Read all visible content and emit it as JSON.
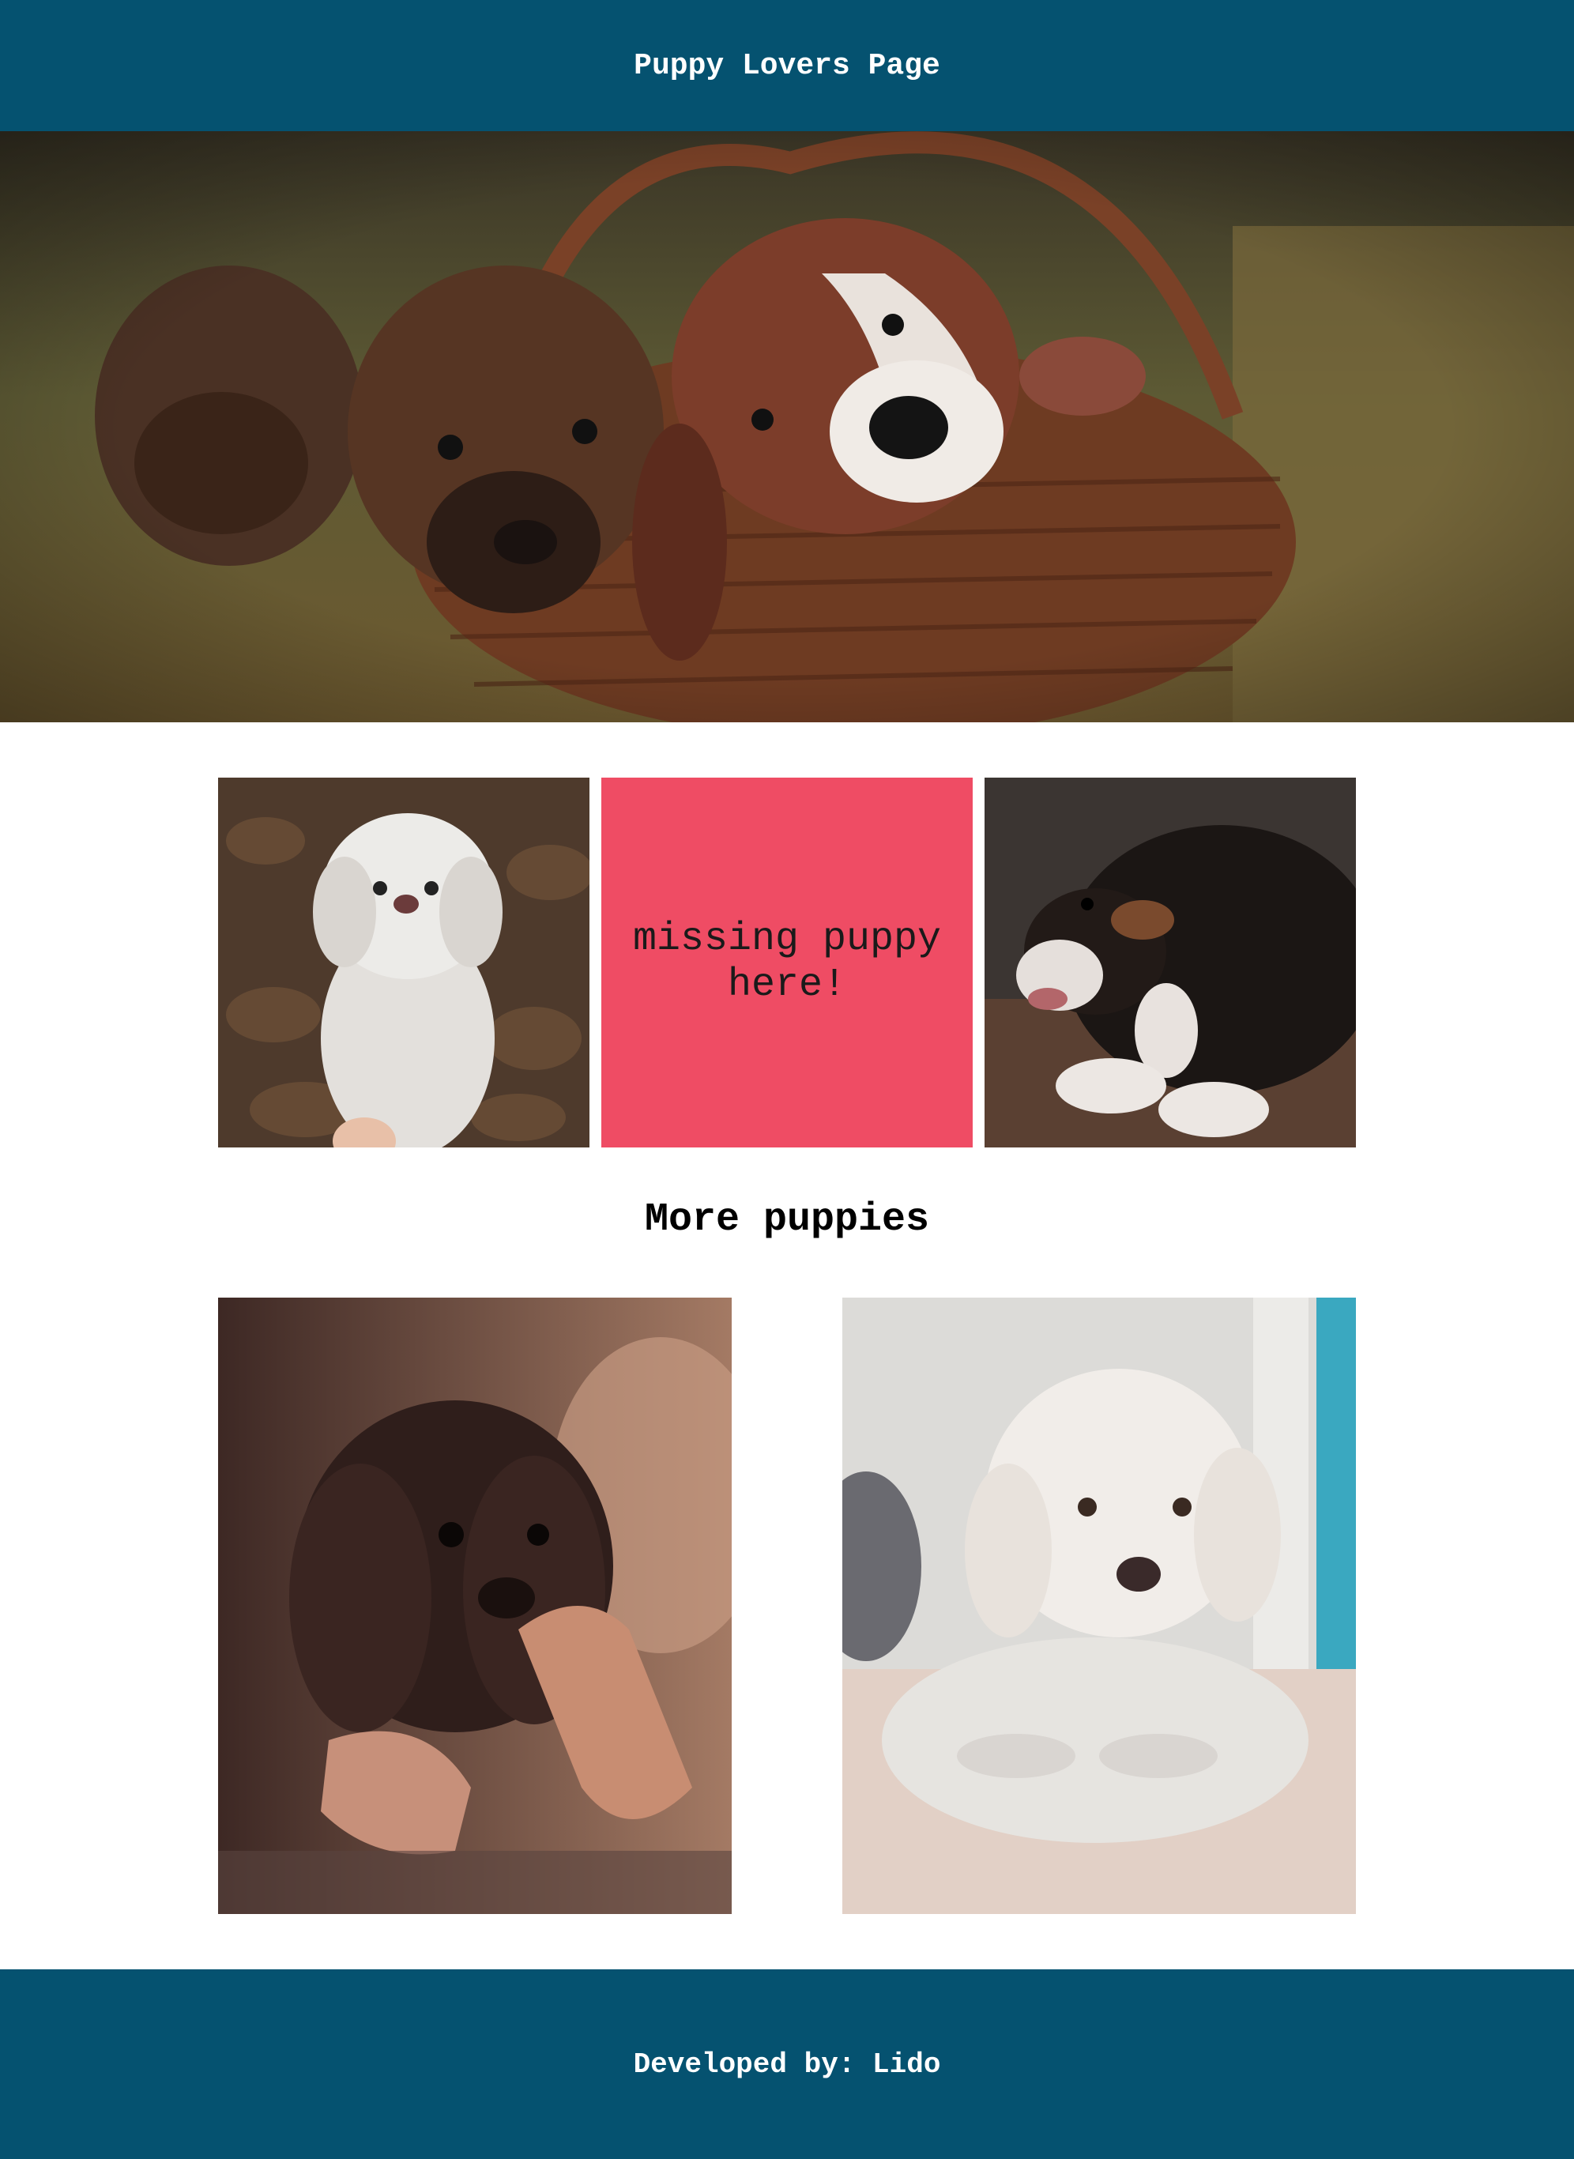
{
  "header": {
    "title": "Puppy Lovers Page"
  },
  "hero": {
    "image": "puppies-in-basket-photo"
  },
  "gallery": {
    "tiles": [
      {
        "image": "white-curly-puppy-photo"
      },
      {
        "placeholder_text": "missing puppy here!",
        "color": "#ef4c64"
      },
      {
        "image": "black-puppy-photo"
      }
    ]
  },
  "more": {
    "title": "More puppies",
    "images": [
      "brown-spaniel-puppy-photo",
      "white-poodle-dog-photo"
    ]
  },
  "footer": {
    "text": "Developed by: Lido"
  },
  "colors": {
    "bar": "#055270",
    "placeholder": "#ef4c64"
  }
}
